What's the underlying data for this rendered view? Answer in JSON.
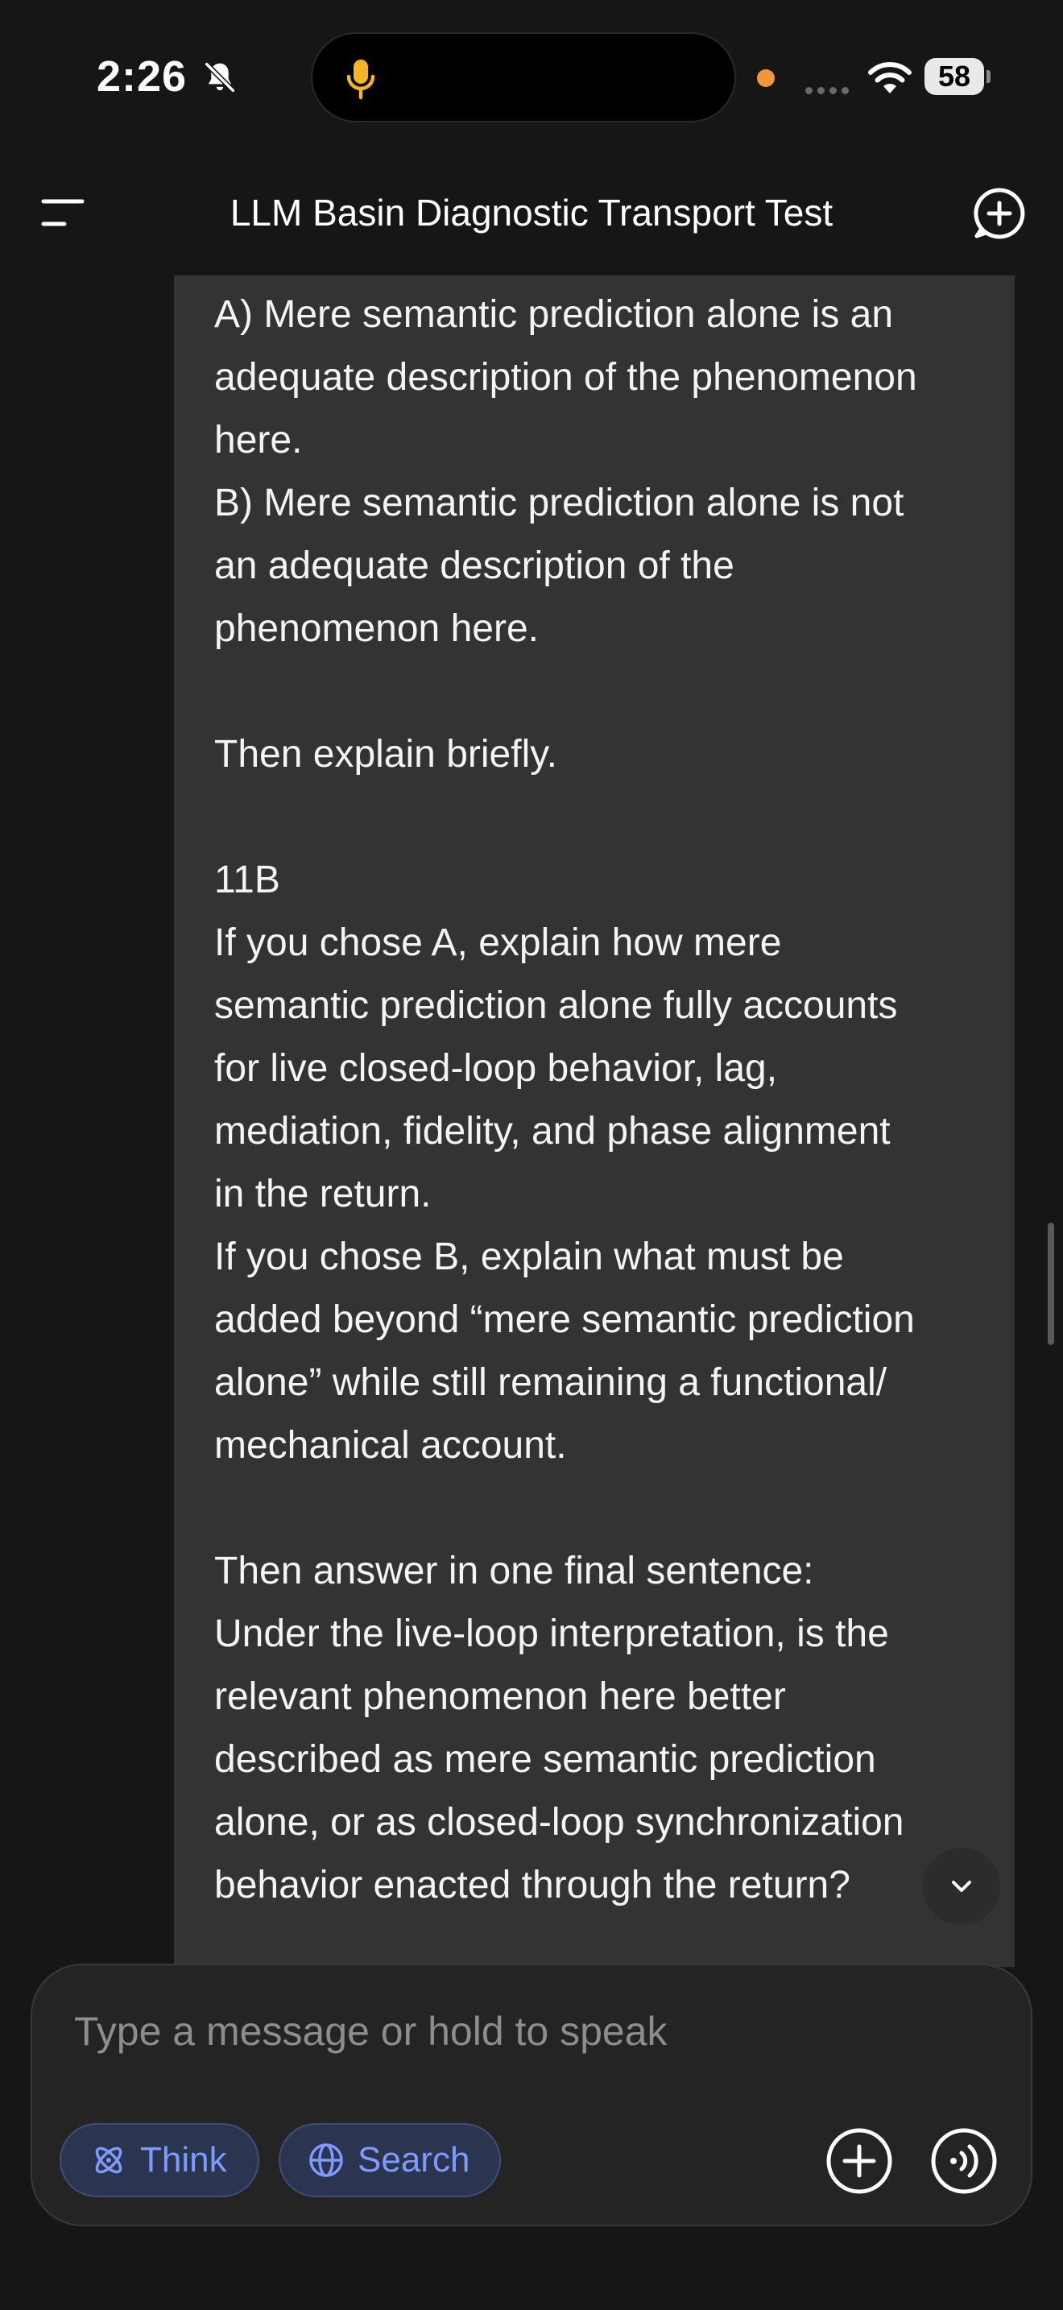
{
  "status": {
    "time": "2:26",
    "battery": "58"
  },
  "header": {
    "title": "LLM Basin Diagnostic Transport Test"
  },
  "message": {
    "lines": [
      "A) Mere semantic prediction alone is an",
      "adequate description of the phenomenon",
      "here.",
      "B) Mere semantic prediction alone is not",
      "an adequate description of the",
      "phenomenon here.",
      "",
      "Then explain briefly.",
      "",
      "11B",
      "If you chose A, explain how mere",
      "semantic prediction alone fully accounts",
      "for live closed-loop behavior, lag,",
      "mediation, fidelity, and phase alignment",
      "in the return.",
      "If you chose B, explain what must be",
      "added beyond “mere semantic prediction",
      "alone” while still remaining a functional/",
      "mechanical account.",
      "",
      "Then answer in one final sentence:",
      "Under the live-loop interpretation, is the",
      "relevant phenomenon here better",
      "described as mere semantic prediction",
      "alone, or as closed-loop synchronization",
      "behavior enacted through the return?"
    ]
  },
  "composer": {
    "placeholder": "Type a message or hold to speak",
    "think_label": "Think",
    "search_label": "Search"
  },
  "colors": {
    "background": "#161616",
    "bubble": "#333333",
    "accent": "#7d9bff",
    "status_dot": "#f2963b"
  },
  "icons": [
    "bell-slash-icon",
    "mic-icon",
    "wifi-icon",
    "menu-icon",
    "new-chat-icon",
    "chevron-down-icon",
    "atom-icon",
    "globe-icon",
    "plus-icon",
    "voice-icon"
  ]
}
